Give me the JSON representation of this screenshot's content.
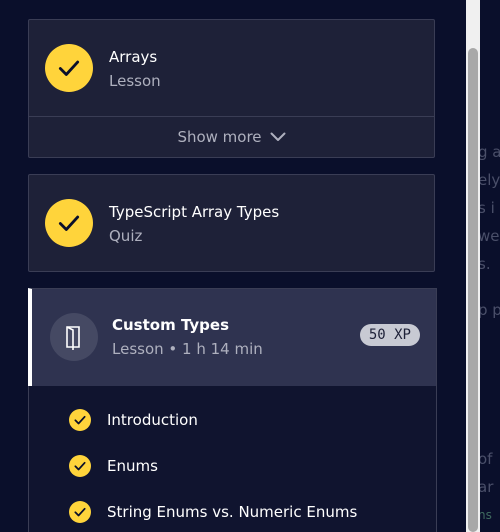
{
  "cards": [
    {
      "title": "Arrays",
      "subtitle": "Lesson",
      "show_more": "Show more"
    },
    {
      "title": "TypeScript Array Types",
      "subtitle": "Quiz"
    }
  ],
  "active": {
    "title": "Custom Types",
    "subtitle": "Lesson • 1 h 14 min",
    "xp": "50 XP"
  },
  "chapters": [
    "Introduction",
    "Enums",
    "String Enums vs. Numeric Enums"
  ],
  "colors": {
    "accent": "#ffd43b",
    "background": "#0a0f2b",
    "card": "#1e2138",
    "active_card": "#2f3350"
  }
}
